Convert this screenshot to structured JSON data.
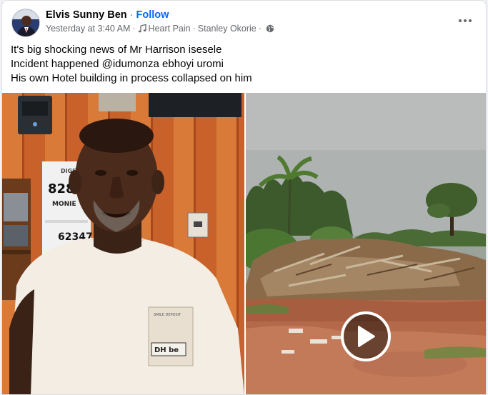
{
  "post": {
    "author_name": "Elvis Sunny Ben",
    "follow_separator": " · ",
    "follow_label": "Follow",
    "timestamp": "Yesterday at 3:40 AM",
    "music_track": "Heart Pain",
    "music_artist": "Stanley Okorie",
    "meta_separator": "·",
    "text_lines": [
      "It's big shocking news of Mr Harrison isesele",
      "Incident happened @idumonza ebhoyi uromi",
      "His own Hotel building in process collapsed on him"
    ]
  },
  "icons": {
    "more": "more-options-icon",
    "music": "music-note-icon",
    "privacy": "globe-icon",
    "play": "play-icon"
  },
  "photo_text": {
    "poster_line1": "DIGITAL W",
    "poster_number1": "828",
    "poster_word": "MONIE",
    "poster_number2": "623475",
    "shirt_tag": "DH be",
    "shirt_pocket": "SMILE DEPOSIT"
  },
  "colors": {
    "follow": "#0866ff",
    "secondary_text": "#65676b",
    "card_bg": "#ffffff",
    "page_bg": "#f0f2f5"
  }
}
